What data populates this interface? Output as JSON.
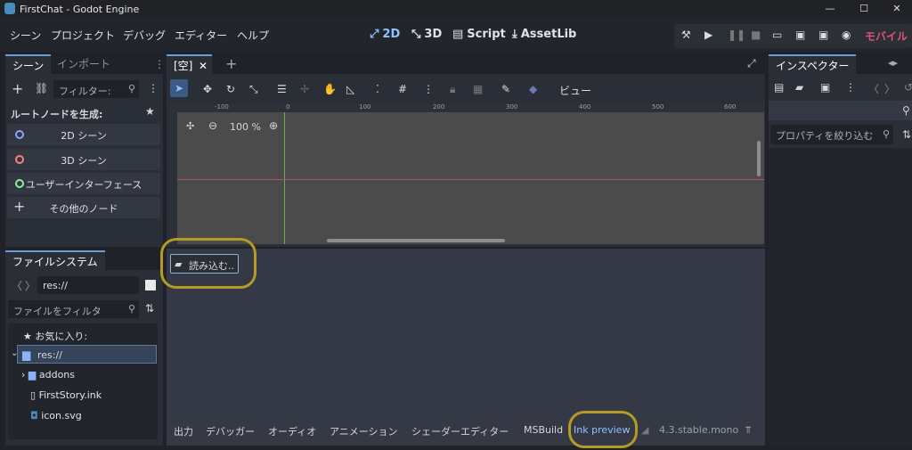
{
  "window": {
    "title": "FirstChat - Godot Engine",
    "min": "—",
    "max": "☐",
    "close": "✕"
  },
  "menu": [
    "シーン",
    "プロジェクト",
    "デバッグ",
    "エディター",
    "ヘルプ"
  ],
  "workspaces": {
    "w2d": "2D",
    "w3d": "3D",
    "script": "Script",
    "assetlib": "AssetLib"
  },
  "renderer": "モバイル",
  "scene_dock": {
    "tab_scene": "シーン",
    "tab_import": "インポート",
    "filter_placeholder": "フィルター:",
    "root_label": "ルートノードを生成:",
    "nodes": [
      "2D シーン",
      "3D シーン",
      "ユーザーインターフェース",
      "その他のノード"
    ]
  },
  "filesystem": {
    "tab": "ファイルシステム",
    "path": "res://",
    "filter_placeholder": "ファイルをフィルタ",
    "favorites": "お気に入り:",
    "res": "res://",
    "items": [
      "addons",
      "FirstStory.ink",
      "icon.svg"
    ]
  },
  "viewport": {
    "tab": "[空]",
    "add": "+",
    "view_menu": "ビュー",
    "zoom": "100 %",
    "ruler": [
      "-100",
      "0",
      "100",
      "200",
      "300",
      "400",
      "500",
      "600"
    ]
  },
  "bottom_panel": {
    "load_button": "読み込む..",
    "tabs": [
      "出力",
      "デバッガー",
      "オーディオ",
      "アニメーション",
      "シェーダーエディター",
      "MSBuild",
      "Ink preview"
    ],
    "version": "4.3.stable.mono"
  },
  "inspector": {
    "tab": "インスペクター",
    "filter_placeholder": "プロパティを絞り込む"
  },
  "colors": {
    "accent": "#8fc4ff",
    "renderer": "#e0527a",
    "highlight": "#b59a23"
  }
}
